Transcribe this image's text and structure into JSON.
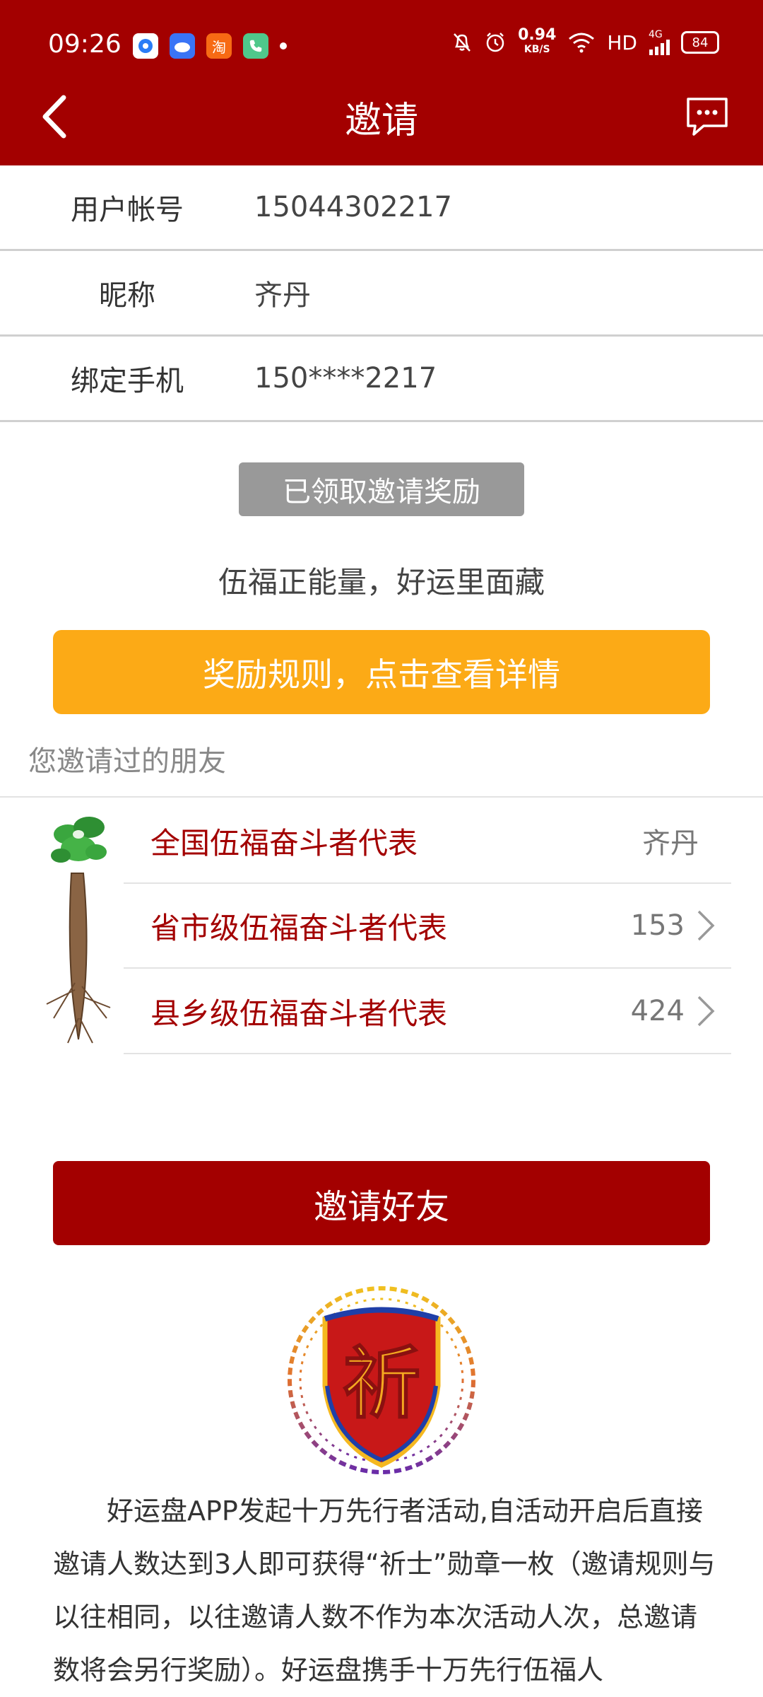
{
  "status_bar": {
    "time": "09:26",
    "net_speed_value": "0.94",
    "net_speed_unit": "KB/S",
    "network": "HD",
    "signal": "4G",
    "battery": "84",
    "app_icon_taobao": "淘"
  },
  "header": {
    "title": "邀请"
  },
  "account": {
    "rows": [
      {
        "label": "用户帐号",
        "value": "15044302217"
      },
      {
        "label": "昵称",
        "value": "齐丹"
      },
      {
        "label": "绑定手机",
        "value": "150****2217"
      }
    ]
  },
  "claimed_button": "已领取邀请奖励",
  "slogan": "伍福正能量，好运里面藏",
  "rules_button": "奖励规则，点击查看详情",
  "friends": {
    "title": "您邀请过的朋友",
    "rows": [
      {
        "label": "全国伍福奋斗者代表",
        "value": "齐丹"
      },
      {
        "label": "省市级伍福奋斗者代表",
        "value": "153"
      },
      {
        "label": "县乡级伍福奋斗者代表",
        "value": "424"
      }
    ]
  },
  "invite_button": "邀请好友",
  "emblem_char": "祈",
  "description": "好运盘APP发起十万先行者活动,自活动开启后直接邀请人数达到3人即可获得“祈士”勋章一枚（邀请规则与以往相同，以往邀请人数不作为本次活动人次，总邀请数将会另行奖励）。好运盘携手十万先行伍福人",
  "colors": {
    "brand_red": "#a30000",
    "accent_orange": "#fcaa16",
    "disabled_gray": "#999999"
  }
}
